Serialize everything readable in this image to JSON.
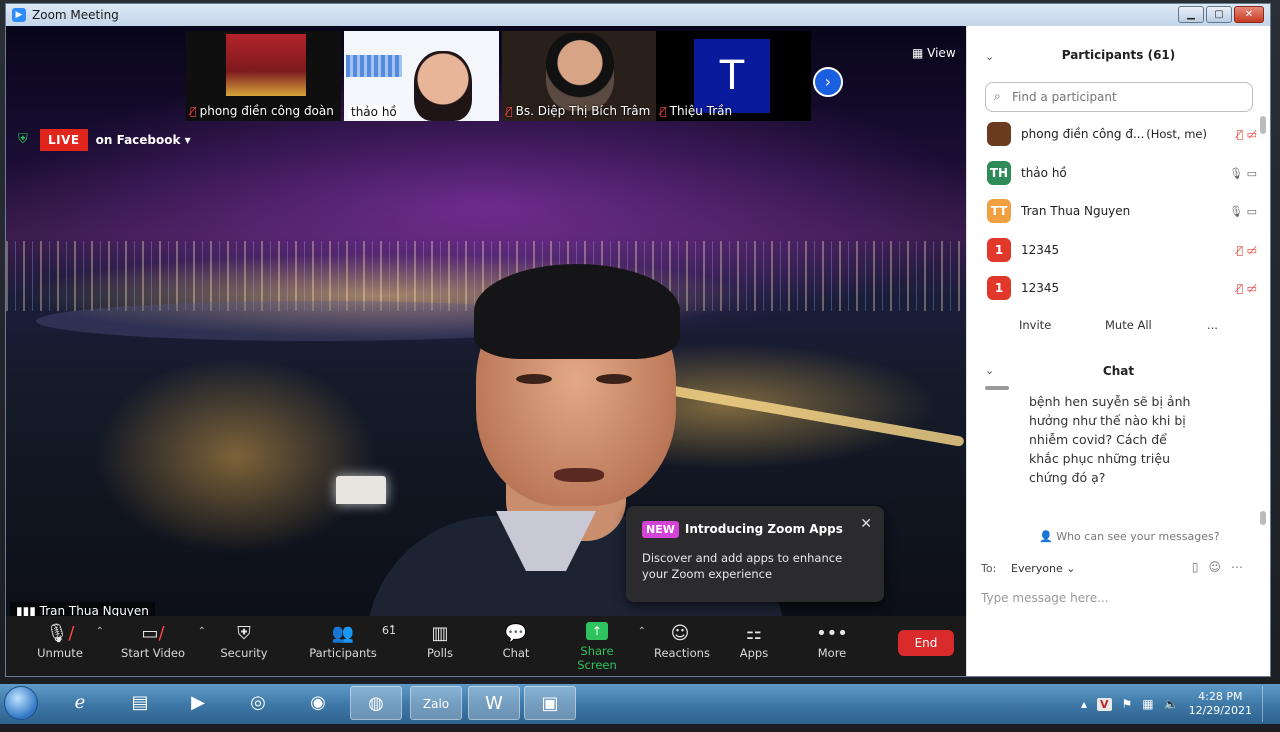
{
  "window": {
    "title": "Zoom Meeting",
    "minimize": "▁",
    "maximize": "▢",
    "close": "✕"
  },
  "thumbnails": [
    {
      "name": "phong điền công đoàn",
      "muted": true
    },
    {
      "name": "thảo hồ",
      "muted": false
    },
    {
      "name": "Bs. Diệp Thị Bích Trâm",
      "muted": true
    },
    {
      "name": "Thiệu Trần",
      "muted": true,
      "avatar_letter": "T"
    }
  ],
  "view_label": "View",
  "live": {
    "badge": "LIVE",
    "platform": "on Facebook",
    "caret": "▾"
  },
  "speaker_name": "Tran Thua Nguyen",
  "toolbar": {
    "unmute": "Unmute",
    "start_video": "Start Video",
    "security": "Security",
    "participants": "Participants",
    "participants_count": "61",
    "polls": "Polls",
    "chat": "Chat",
    "share_screen": "Share Screen",
    "reactions": "Reactions",
    "apps": "Apps",
    "more": "More",
    "end": "End"
  },
  "popup": {
    "tag": "NEW",
    "title": "Introducing Zoom Apps",
    "body": "Discover and add apps to enhance your Zoom experience",
    "close": "✕"
  },
  "participants_panel": {
    "title": "Participants (61)",
    "search_placeholder": "Find a participant",
    "rows": [
      {
        "initials": "",
        "name": "phong điền công đ...",
        "tag": "(Host, me)",
        "color": "#6b3b20",
        "muted": true
      },
      {
        "initials": "TH",
        "name": "thảo hồ",
        "tag": "",
        "color": "#2e8b57",
        "muted": false
      },
      {
        "initials": "TT",
        "name": "Tran Thua Nguyen",
        "tag": "",
        "color": "#f0a040",
        "muted": false
      },
      {
        "initials": "1",
        "name": "12345",
        "tag": "",
        "color": "#e0392b",
        "muted": true
      },
      {
        "initials": "1",
        "name": "12345",
        "tag": "",
        "color": "#e0392b",
        "muted": true
      }
    ],
    "invite": "Invite",
    "mute_all": "Mute All",
    "more": "..."
  },
  "chat_panel": {
    "title": "Chat",
    "message": "bệnh hen suyễn sẽ bị ảnh hưởng như thế nào khi bị nhiễm covid? Cách để khắc phục những triệu chứng đó ạ?",
    "who_can_see": "Who can see your messages?",
    "to_label": "To:",
    "to_value": "Everyone",
    "input_placeholder": "Type message here..."
  },
  "tray": {
    "time": "4:28 PM",
    "date": "12/29/2021"
  },
  "colors": {
    "live_red": "#e0251a",
    "end_red": "#d92b2b",
    "share_green": "#2ec35e",
    "new_tag": "#d542d6"
  }
}
